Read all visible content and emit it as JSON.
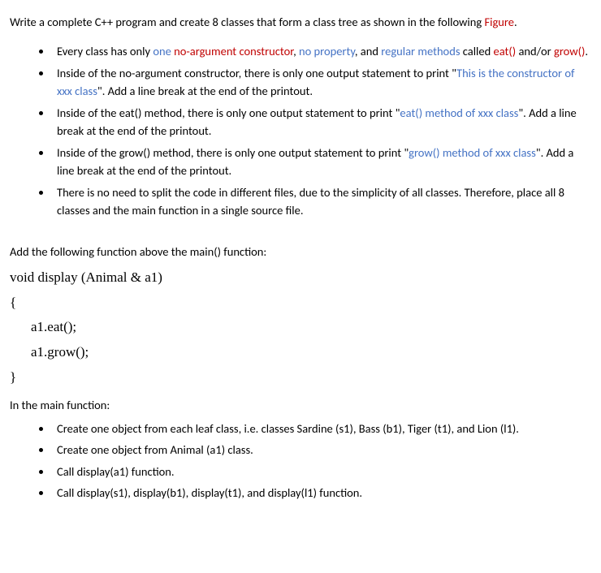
{
  "intro": {
    "t1": "Write a complete C++ program and create 8 classes that form a class tree as shown in the following ",
    "figure": "Figure",
    "period": "."
  },
  "bullets1": [
    {
      "pre": "Every class has only ",
      "blue1": "one ",
      "red1": "no-argument constructor",
      "mid1": ", ",
      "blue2": "no property",
      "mid2": ", and ",
      "blue3": "regular methods",
      "mid3": " called ",
      "red2": "eat()",
      "mid4": " and/or ",
      "red3": "grow()",
      "tail": "."
    },
    {
      "pre": "Inside of the no-argument constructor, there is only one output statement to print \"",
      "blue1": "This is the constructor of xxx class",
      "tail": "\". Add a line break at the end of the printout."
    },
    {
      "pre": "Inside of the eat() method, there is only one output statement to print \"",
      "blue1": "eat() method of xxx class",
      "tail": "\". Add a line break at the end of the printout."
    },
    {
      "pre": "Inside of the grow() method, there is only one output statement to print \"",
      "blue1": "grow() method of xxx class",
      "tail": "\". Add a line break at the end of the printout."
    },
    {
      "pre": "There is no need to split the code in different files, due to the simplicity of all classes. Therefore, place all 8 classes and the main function in a single source file."
    }
  ],
  "section_add": "Add the following function above the main() function:",
  "code": {
    "l1": "void display (Animal & a1)",
    "l2": "{",
    "l3": "a1.eat();",
    "l4": "a1.grow();",
    "l5": "}"
  },
  "section_main": "In the main function:",
  "bullets2": [
    "Create one object from each leaf class, i.e. classes Sardine (s1), Bass (b1), Tiger (t1), and Lion (l1).",
    "Create one object from Animal (a1) class.",
    "Call display(a1) function.",
    "Call display(s1), display(b1), display(t1), and display(l1) function."
  ]
}
